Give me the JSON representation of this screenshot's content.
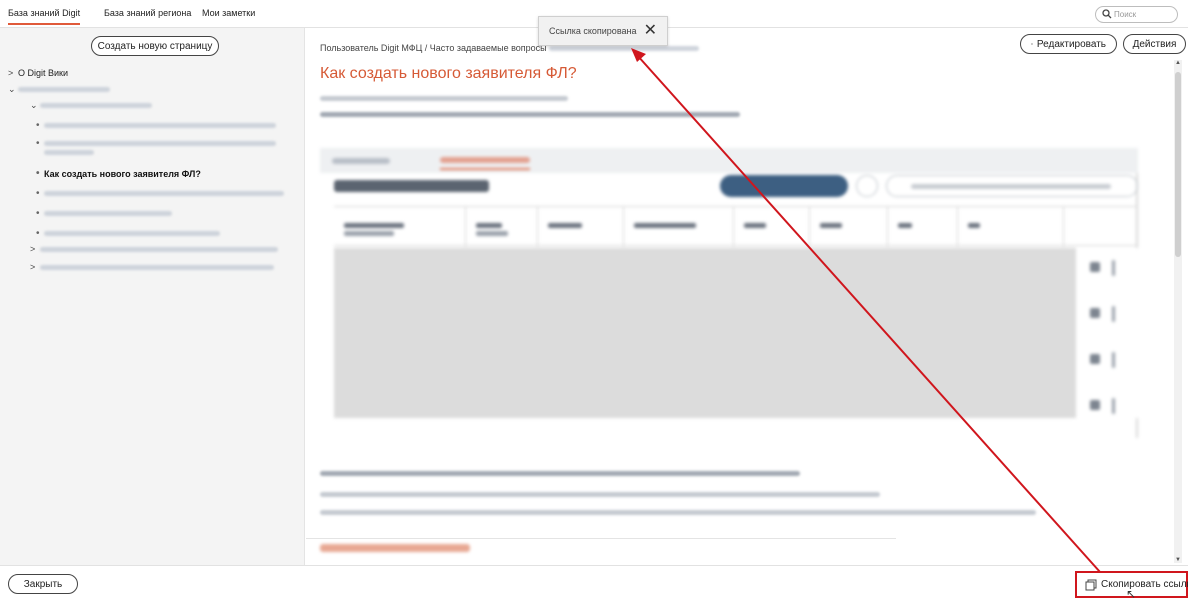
{
  "topbar": {
    "tabs": [
      {
        "label": "База знаний Digit",
        "active": true
      },
      {
        "label": "База знаний региона",
        "active": false
      },
      {
        "label": "Мои заметки",
        "active": false
      }
    ],
    "search": {
      "placeholder": "Поиск",
      "icon": "search-icon"
    }
  },
  "sidebar": {
    "create_button": "Создать новую страницу",
    "tree": [
      {
        "label": "О Digit Вики",
        "arrow": ">",
        "level": 0
      },
      {
        "label": "",
        "arrow": "v",
        "level": 0
      },
      {
        "label": "",
        "arrow": "v",
        "level": 1
      },
      {
        "label": "",
        "level": 2
      },
      {
        "label": "",
        "level": 2
      },
      {
        "label": "Как создать нового заявителя ФЛ?",
        "level": 2,
        "current": true
      },
      {
        "label": "",
        "level": 2
      },
      {
        "label": "",
        "level": 2
      },
      {
        "label": "",
        "level": 2
      },
      {
        "label": "",
        "arrow": ">",
        "level": 1
      },
      {
        "label": "",
        "arrow": ">",
        "level": 1
      }
    ],
    "close_button": "Закрыть"
  },
  "main": {
    "breadcrumb": "Пользователь Digit МФЦ / Часто задаваемые вопросы",
    "title": "Как создать нового заявителя ФЛ?",
    "edit_button": "Редактировать",
    "edit_icon": "list-icon",
    "actions_button": "Действия"
  },
  "toast": {
    "text": "Ссылка скопирована",
    "close_icon": "close-icon"
  },
  "footer": {
    "copy_link": "Скопировать ссылку",
    "copy_icon": "copy-icon"
  },
  "colors": {
    "accent": "#d65a36",
    "annotation": "#d0161d"
  }
}
